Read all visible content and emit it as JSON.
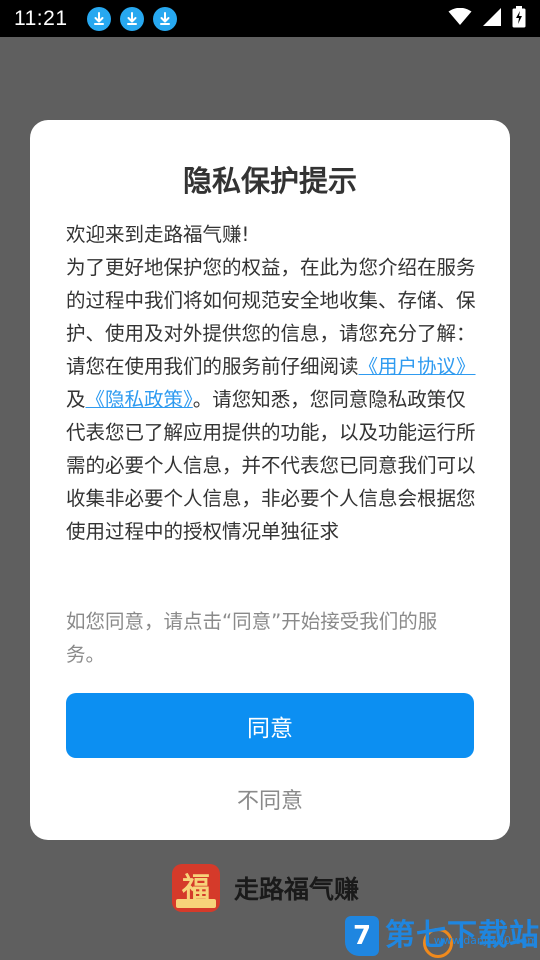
{
  "status_bar": {
    "time": "11:21",
    "download_icons": [
      "download-icon",
      "download-icon",
      "download-icon"
    ],
    "right_icons": [
      "wifi-icon",
      "signal-icon",
      "battery-charging-icon"
    ]
  },
  "dialog": {
    "title": "隐私保护提示",
    "welcome": "欢迎来到走路福气赚!",
    "intro": "为了更好地保护您的权益，在此为您介绍在服务的过程中我们将如何规范安全地收集、存储、保护、使用及对外提供您的信息，请您充分了解：",
    "read_prefix": "请您在使用我们的服务前仔细阅读",
    "user_agreement_link": "《用户协议》",
    "and_text": "及",
    "privacy_policy_link": "《隐私政策》",
    "read_suffix": "。请您知悉，您同意隐私政策仅代表您已了解应用提供的功能，以及功能运行所需的必要个人信息，并不代表您已同意我们可以收集非必要个人信息，非必要个人信息会根据您使用过程中的授权情况单独征求",
    "hint": "如您同意，请点击“同意”开始接受我们的服务。",
    "agree_label": "同意",
    "disagree_label": "不同意"
  },
  "brand": {
    "logo_char": "福",
    "name": "走路福气赚"
  },
  "watermark": {
    "badge": "7",
    "name": "第七下载站",
    "url": "www.danji100.com"
  },
  "colors": {
    "accent": "#0c8ff2",
    "link": "#2f9bf0",
    "overlay": "#5f5f5f",
    "status_download": "#27a8f0"
  }
}
